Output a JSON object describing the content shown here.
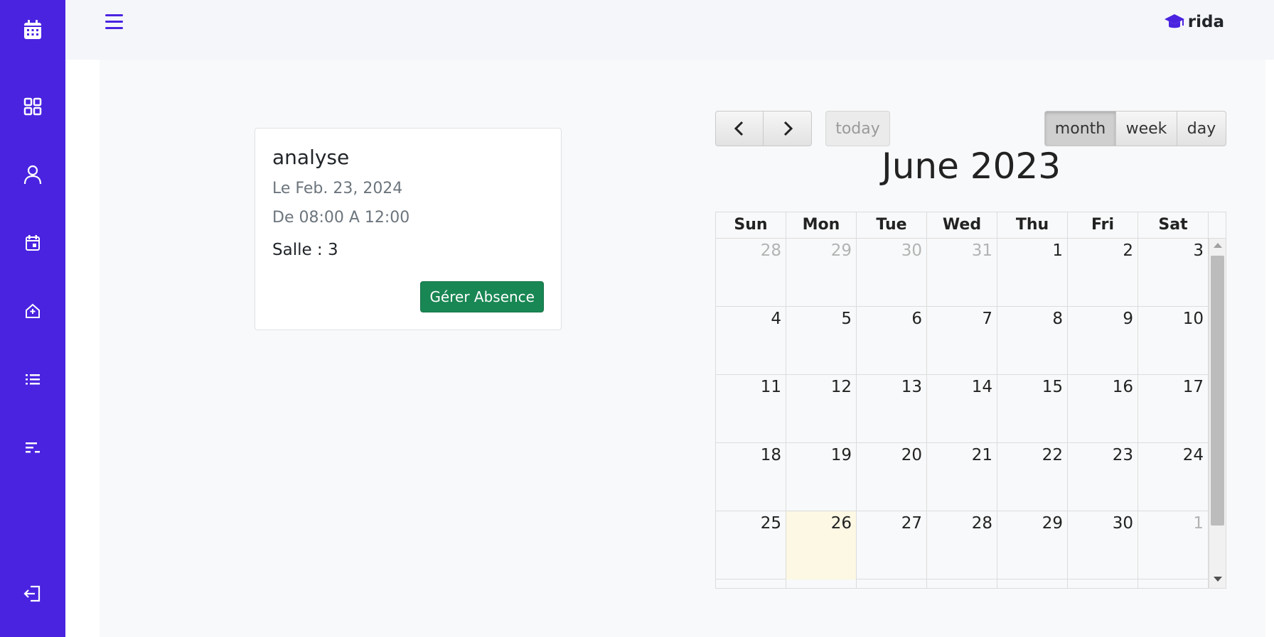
{
  "sidebar": {
    "items": [
      {
        "icon": "calendar-grid-icon"
      },
      {
        "icon": "dashboard-icon"
      },
      {
        "icon": "user-icon"
      },
      {
        "icon": "calendar-event-icon"
      },
      {
        "icon": "home-plus-icon"
      },
      {
        "icon": "list-icon"
      },
      {
        "icon": "list-sort-icon"
      },
      {
        "icon": "logout-icon"
      }
    ],
    "color": "#4a23e0"
  },
  "header": {
    "brand": "rida",
    "brand_icon": "graduation-cap-icon",
    "menu_icon": "hamburger-icon"
  },
  "course": {
    "title": "analyse",
    "date": "Le Feb. 23, 2024",
    "time": "De 08:00 A 12:00",
    "room": "Salle : 3",
    "button_label": "Gérer Absence"
  },
  "calendar": {
    "title": "June 2023",
    "today_label": "today",
    "views": {
      "month": "month",
      "week": "week",
      "day": "day"
    },
    "active_view": "month",
    "days_of_week": [
      "Sun",
      "Mon",
      "Tue",
      "Wed",
      "Thu",
      "Fri",
      "Sat"
    ],
    "weeks": [
      [
        {
          "d": "28",
          "o": true
        },
        {
          "d": "29",
          "o": true
        },
        {
          "d": "30",
          "o": true
        },
        {
          "d": "31",
          "o": true
        },
        {
          "d": "1"
        },
        {
          "d": "2"
        },
        {
          "d": "3"
        }
      ],
      [
        {
          "d": "4"
        },
        {
          "d": "5"
        },
        {
          "d": "6"
        },
        {
          "d": "7"
        },
        {
          "d": "8"
        },
        {
          "d": "9"
        },
        {
          "d": "10"
        }
      ],
      [
        {
          "d": "11"
        },
        {
          "d": "12"
        },
        {
          "d": "13"
        },
        {
          "d": "14"
        },
        {
          "d": "15"
        },
        {
          "d": "16"
        },
        {
          "d": "17"
        }
      ],
      [
        {
          "d": "18"
        },
        {
          "d": "19"
        },
        {
          "d": "20"
        },
        {
          "d": "21"
        },
        {
          "d": "22"
        },
        {
          "d": "23"
        },
        {
          "d": "24"
        }
      ],
      [
        {
          "d": "25"
        },
        {
          "d": "26",
          "t": true
        },
        {
          "d": "27"
        },
        {
          "d": "28"
        },
        {
          "d": "29"
        },
        {
          "d": "30"
        },
        {
          "d": "1",
          "o": true
        }
      ],
      [
        {
          "d": ""
        },
        {
          "d": ""
        },
        {
          "d": ""
        },
        {
          "d": ""
        },
        {
          "d": ""
        },
        {
          "d": ""
        },
        {
          "d": ""
        }
      ]
    ],
    "today_highlight_color": "#fcf8e3"
  }
}
